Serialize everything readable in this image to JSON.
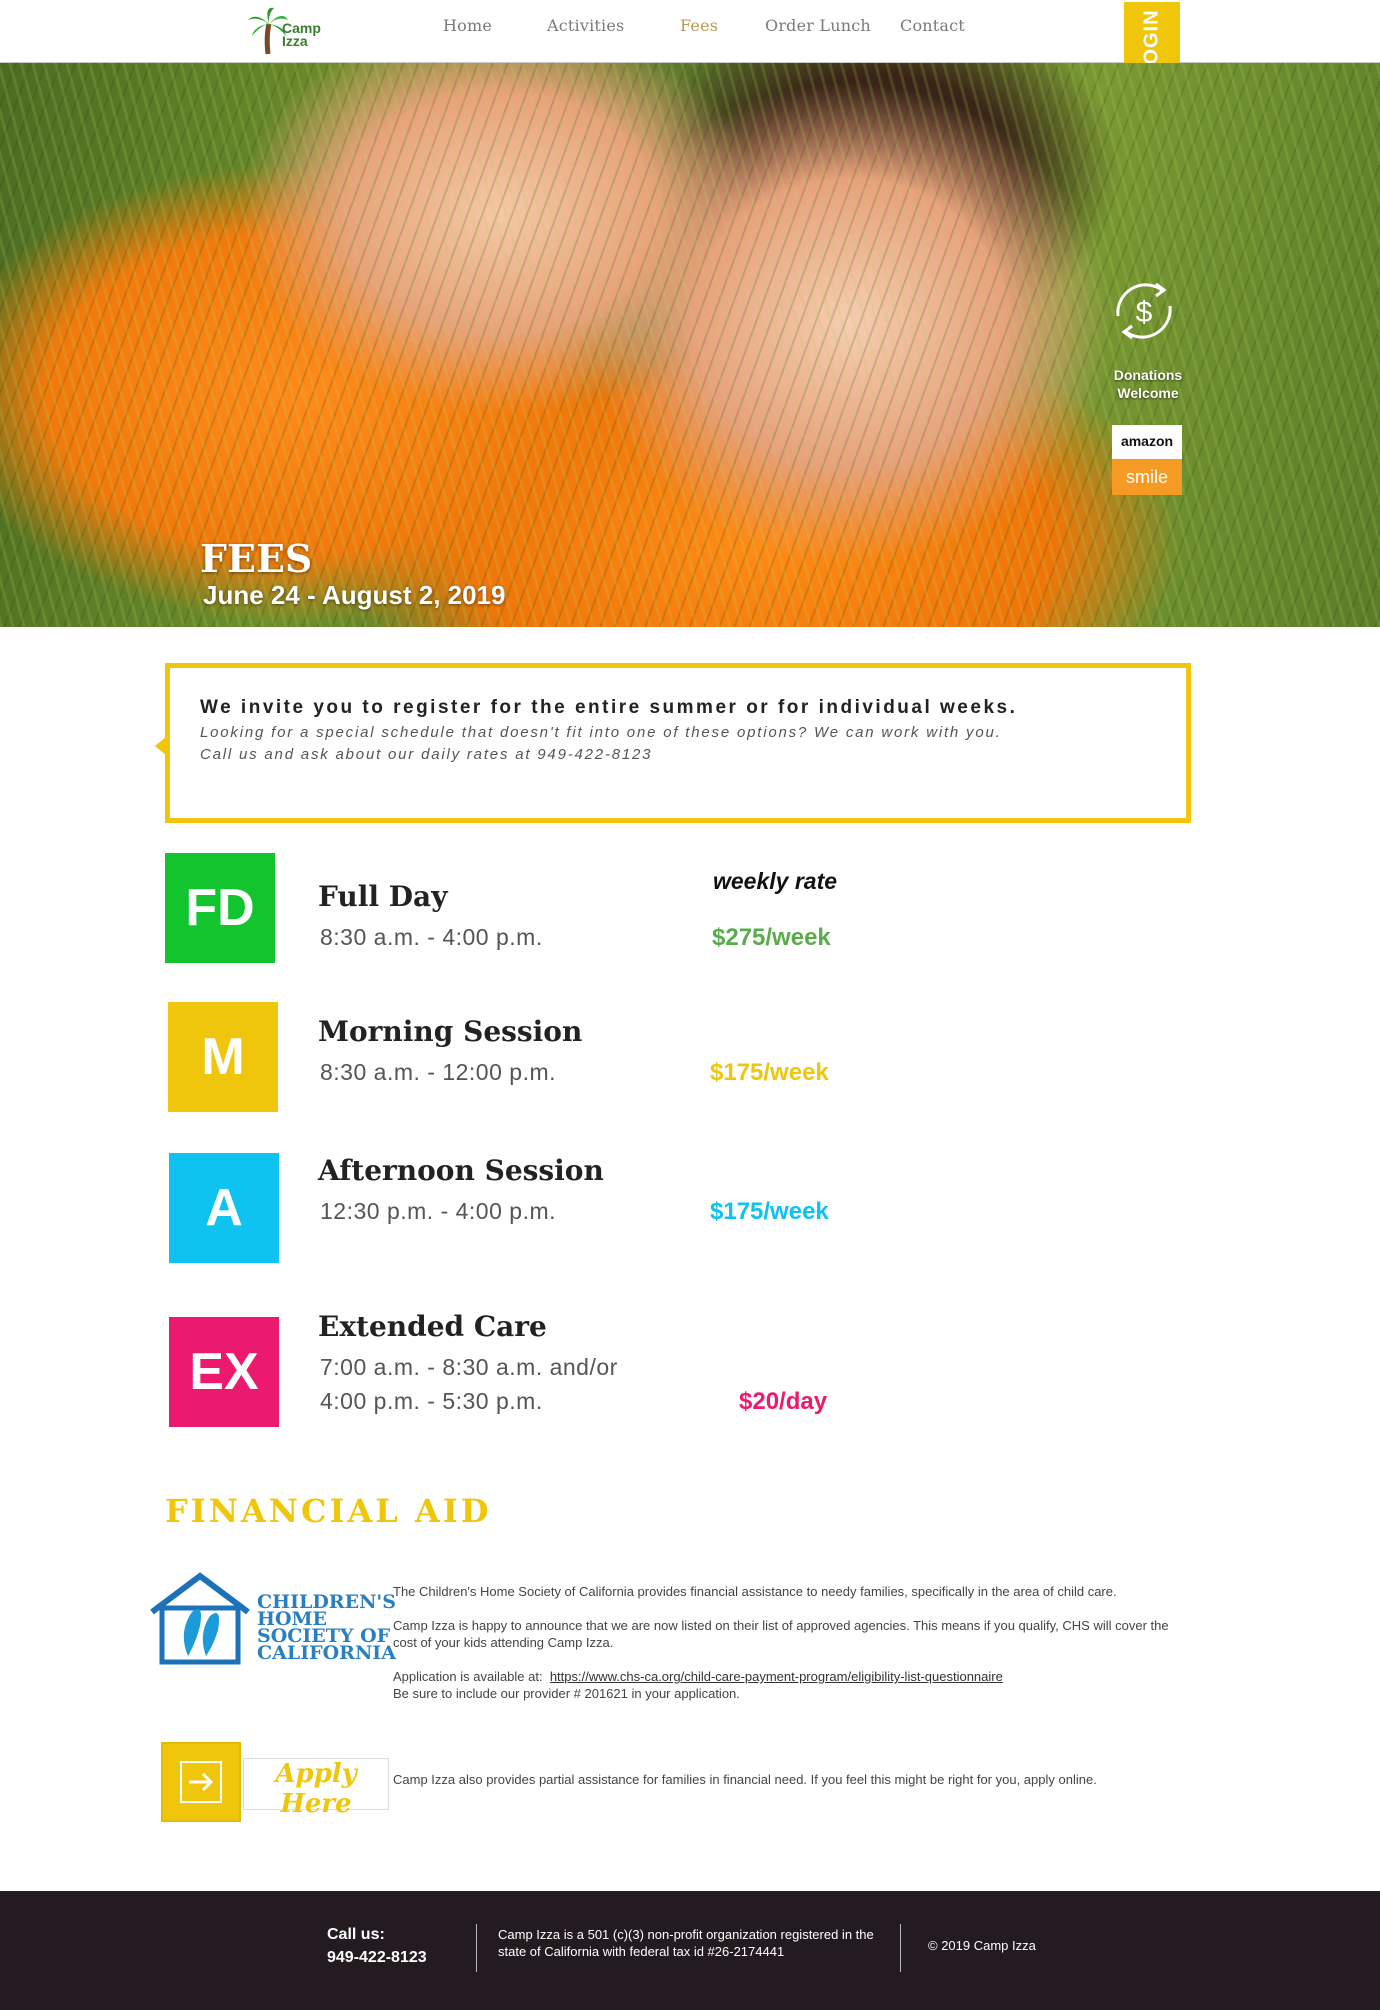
{
  "header": {
    "logo_text": "Camp Izza",
    "nav": [
      "Home",
      "Activities",
      "Fees",
      "Order Lunch",
      "Contact"
    ],
    "active_nav": "Fees",
    "register_label": "REGISTER/LOGIN"
  },
  "hero": {
    "title": "FEES",
    "dates": "June 24 - August 2, 2019",
    "donate_label_line1": "Donations",
    "donate_label_line2": "Welcome",
    "amazon_top": "amazon",
    "amazon_bottom": "smile"
  },
  "intro": {
    "heading": "We invite you to register for the entire summer or for individual weeks.",
    "line1": "Looking for a special schedule that doesn't fit into one of these options? We can work with you.",
    "line2": "Call us and ask about our daily rates at 949-422-8123"
  },
  "weekly_rate_label": "weekly rate",
  "plans": [
    {
      "code": "FD",
      "name": "Full Day",
      "hours": "8:30 a.m. - 4:00 p.m.",
      "hours2": "",
      "price": "$275/week",
      "color": "#12c42e",
      "price_color": "#5aac4a"
    },
    {
      "code": "M",
      "name": "Morning Session",
      "hours": "8:30 a.m. - 12:00 p.m.",
      "hours2": "",
      "price": "$175/week",
      "color": "#efc60b",
      "price_color": "#efc60b"
    },
    {
      "code": "A",
      "name": "Afternoon Session",
      "hours": "12:30 p.m. - 4:00 p.m.",
      "hours2": "",
      "price": "$175/week",
      "color": "#0ec3ef",
      "price_color": "#0ec3ef"
    },
    {
      "code": "EX",
      "name": "Extended Care",
      "hours": "7:00 a.m. - 8:30 a.m. and/or",
      "hours2": "4:00 p.m. - 5:30 p.m.",
      "price": "$20/day",
      "color": "#eb1a6e",
      "price_color": "#eb1a6e"
    }
  ],
  "financial_aid": {
    "title": "FINANCIAL AID",
    "chs_logo_text": "CHILDREN'S HOME SOCIETY OF CALIFORNIA",
    "chs_line1": "CHILDREN'S",
    "chs_line2": "HOME",
    "chs_line3": "SOCIETY OF",
    "chs_line4": "CALIFORNIA",
    "para1": "The Children's Home Society of California provides financial assistance to needy families, specifically in the area of child care.",
    "para2": "Camp Izza is happy to announce that we are now listed on their list of approved agencies. This means if you qualify, CHS will cover the cost of your kids attending Camp Izza.",
    "application_prefix": "Application is available at:",
    "application_link": "https://www.chs-ca.org/child-care-payment-program/eligibility-list-questionnaire",
    "provider_note": "Be sure to include our provider # 201621 in your application.",
    "apply_label": "Apply Here",
    "apply_text": "Camp Izza also provides partial assistance for families in financial need. If you feel this might be right for you, apply online."
  },
  "footer": {
    "call_label": "Call us:",
    "phone": "949-422-8123",
    "nonprofit": "Camp Izza is a 501 (c)(3) non-profit organization registered in the state of California with federal tax id #26-2174441",
    "copyright": "© 2019 Camp Izza"
  },
  "colors": {
    "accent_yellow": "#efc60b",
    "footer_bg": "#231b1f"
  }
}
